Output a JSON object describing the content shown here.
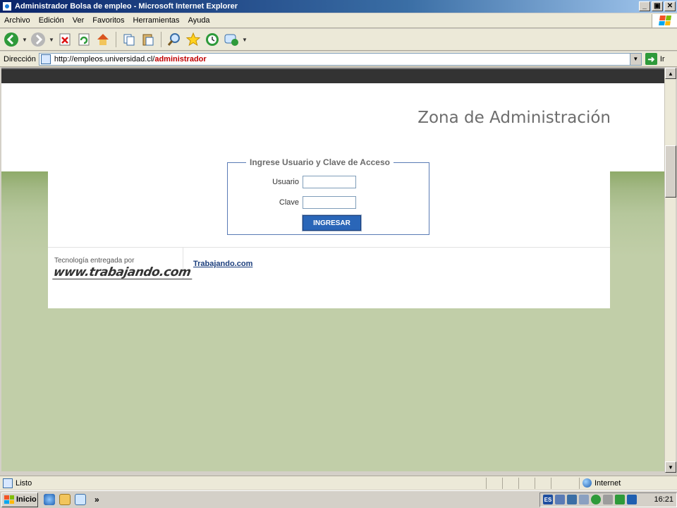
{
  "window": {
    "title": "Administrador Bolsa de empleo - Microsoft Internet Explorer",
    "controls": {
      "minimize": "_",
      "maximize": "▣",
      "close": "✕"
    }
  },
  "menu": [
    "Archivo",
    "Edición",
    "Ver",
    "Favoritos",
    "Herramientas",
    "Ayuda"
  ],
  "toolbar": {
    "buttons": [
      "back-icon",
      "forward-icon",
      "stop-icon",
      "refresh-icon",
      "home-icon",
      "copy-icon",
      "paste-icon",
      "search-icon",
      "favorites-icon",
      "history-icon",
      "messenger-icon"
    ]
  },
  "address": {
    "label": "Dirección",
    "url_base": "http://empleos.universidad.cl/",
    "url_highlight": "administrador",
    "go_label": "Ir"
  },
  "page": {
    "title": "Zona de Administración",
    "login": {
      "legend": "Ingrese Usuario y Clave de Acceso",
      "user_label": "Usuario",
      "user_value": "",
      "password_label": "Clave",
      "password_value": "",
      "submit": "INGRESAR"
    },
    "footer": {
      "tech_text": "Tecnología entregada por",
      "logo_text": "www.trabajando.com",
      "link": "Trabajando.com"
    }
  },
  "colors": {
    "page_green": "#c1cea8",
    "header_bar": "#333333",
    "button_blue": "#2a66b8",
    "title_gray": "#6d6d6d"
  },
  "status": {
    "text": "Listo",
    "zone": "Internet"
  },
  "taskbar": {
    "start": "Inicio",
    "chevron": "»",
    "lang": "ES",
    "time": "16:21"
  }
}
